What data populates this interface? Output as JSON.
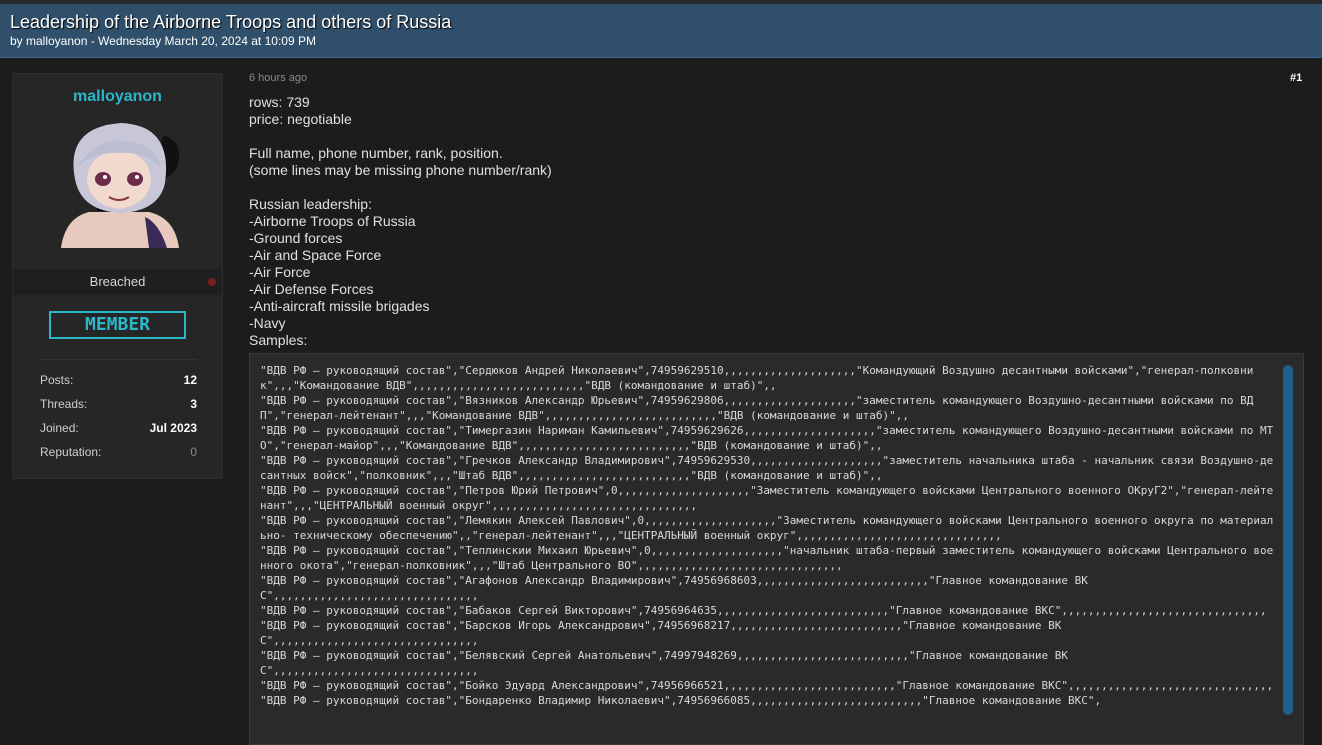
{
  "thread": {
    "title": "Leadership of the Airborne Troops and others of Russia",
    "meta": "by malloyanon - Wednesday March 20, 2024 at 10:09 PM"
  },
  "user": {
    "username": "malloyanon",
    "status": "Breached",
    "rank": "MEMBER",
    "stats": [
      {
        "label": "Posts:",
        "value": "12"
      },
      {
        "label": "Threads:",
        "value": "3"
      },
      {
        "label": "Joined:",
        "value": "Jul 2023"
      },
      {
        "label": "Reputation:",
        "value": "0"
      }
    ]
  },
  "post": {
    "time": "6 hours ago",
    "number": "#1",
    "body": "rows: 739\nprice: negotiable\n\nFull name, phone number, rank, position.\n(some lines may be missing phone number/rank)\n\nRussian leadership:\n-Airborne Troops of Russia\n-Ground forces\n-Air and Space Force\n-Air Force\n-Air Defense Forces\n-Anti-aircraft missile brigades\n-Navy\nSamples:",
    "code": "\"ВДВ РФ – руководящий состав\",\"Сердюков Андрей Николаевич\",74959629510,,,,,,,,,,,,,,,,,,,,\"Командующий Воздушно десантными войсками\",\"генерал-полковник\",,,\"Командование ВДВ\",,,,,,,,,,,,,,,,,,,,,,,,,,\"ВДВ (командование и штаб)\",,\n\"ВДВ РФ – руководящий состав\",\"Вязников Александр Юрьевич\",74959629806,,,,,,,,,,,,,,,,,,,,\"заместитель командующего Воздушно-десантными войсками по ВДП\",\"генерал-лейтенант\",,,\"Командование ВДВ\",,,,,,,,,,,,,,,,,,,,,,,,,,\"ВДВ (командование и штаб)\",,\n\"ВДВ РФ – руководящий состав\",\"Тимергазин Нариман Камильевич\",74959629626,,,,,,,,,,,,,,,,,,,,\"заместитель командующего Воздушно-десантными войсками по МТО\",\"генерал-майор\",,,\"Командование ВДВ\",,,,,,,,,,,,,,,,,,,,,,,,,,\"ВДВ (командование и штаб)\",,\n\"ВДВ РФ – руководящий состав\",\"Гречков Александр Владимирович\",74959629530,,,,,,,,,,,,,,,,,,,,\"заместитель начальника штаба - начальник связи Воздушно-десантных войск\",\"полковник\",,,\"Штаб ВДВ\",,,,,,,,,,,,,,,,,,,,,,,,,,\"ВДВ (командование и штаб)\",,\n\"ВДВ РФ – руководящий состав\",\"Петров Юрий Петрович\",0,,,,,,,,,,,,,,,,,,,,\"Заместитель командующего войсками Центрального военного ОКруГ2\",\"генерал-лейтенант\",,,\"ЦЕНТРАЛЬНЫЙ военный округ\",,,,,,,,,,,,,,,,,,,,,,,,,,,,,,,\n\"ВДВ РФ – руководящий состав\",\"Лемякин Алексей Павлович\",0,,,,,,,,,,,,,,,,,,,,\"Заместитель командующего войсками Центрального военного округа по материально- техническому обеспечению\",,\"генерал-лейтенант\",,,\"ЦЕНТРАЛЬНЫЙ военный округ\",,,,,,,,,,,,,,,,,,,,,,,,,,,,,,,\n\"ВДВ РФ – руководящий состав\",\"Теплинскии Михаил Юрьевич\",0,,,,,,,,,,,,,,,,,,,,\"начальник штаба-первый заместитель командующего войсками Центрального военного окота\",\"генерал-полковник\",,,\"Штаб Центрального ВО\",,,,,,,,,,,,,,,,,,,,,,,,,,,,,,,\n\"ВДВ РФ – руководящий состав\",\"Агафонов Александр Владимирович\",74956968603,,,,,,,,,,,,,,,,,,,,,,,,,,\"Главное командование ВКС\",,,,,,,,,,,,,,,,,,,,,,,,,,,,,,,\n\"ВДВ РФ – руководящий состав\",\"Бабаков Сергей Викторович\",74956964635,,,,,,,,,,,,,,,,,,,,,,,,,,\"Главное командование ВКС\",,,,,,,,,,,,,,,,,,,,,,,,,,,,,,,\n\"ВДВ РФ – руководящий состав\",\"Барсков Игорь Александрович\",74956968217,,,,,,,,,,,,,,,,,,,,,,,,,,\"Главное командование ВКС\",,,,,,,,,,,,,,,,,,,,,,,,,,,,,,,\n\"ВДВ РФ – руководящий состав\",\"Белявский Сергей Анатольевич\",74997948269,,,,,,,,,,,,,,,,,,,,,,,,,,\"Главное командование ВКС\",,,,,,,,,,,,,,,,,,,,,,,,,,,,,,,\n\"ВДВ РФ – руководящий состав\",\"Бойко Эдуард Александрович\",74956966521,,,,,,,,,,,,,,,,,,,,,,,,,,\"Главное командование ВКС\",,,,,,,,,,,,,,,,,,,,,,,,,,,,,,,\n\"ВДВ РФ – руководящий состав\",\"Бондаренко Владимир Николаевич\",74956966085,,,,,,,,,,,,,,,,,,,,,,,,,,\"Главное командование ВКС\","
  }
}
